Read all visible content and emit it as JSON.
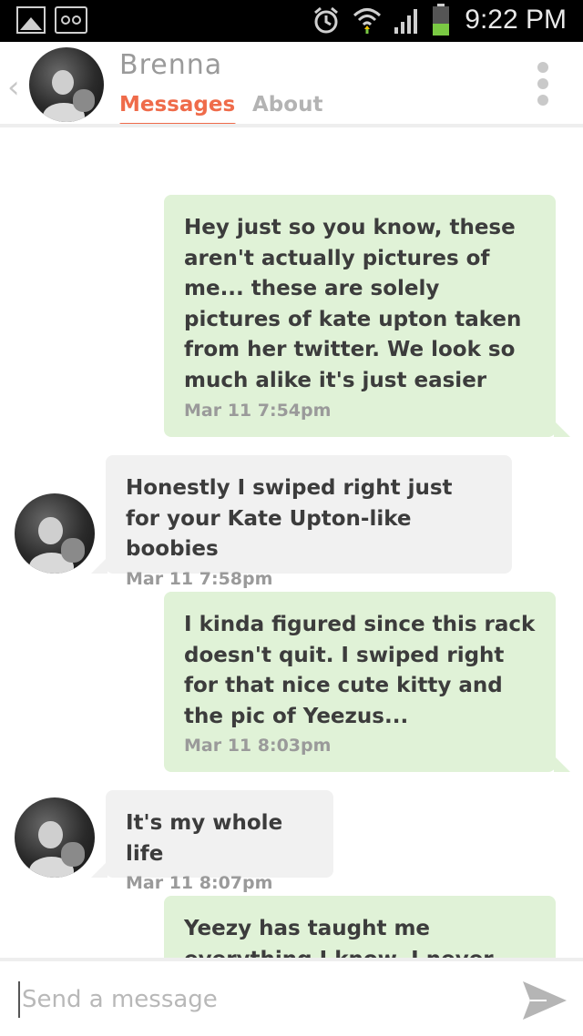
{
  "status_bar": {
    "time": "9:22 PM",
    "icons": [
      "gallery-icon",
      "voicemail-icon",
      "alarm-icon",
      "wifi-icon",
      "signal-icon",
      "battery-icon"
    ]
  },
  "header": {
    "name": "Brenna",
    "tabs": [
      {
        "label": "Messages",
        "active": true
      },
      {
        "label": "About",
        "active": false
      }
    ],
    "accent_color": "#ef6b4a"
  },
  "messages": [
    {
      "direction": "sent",
      "text": "Hey just so you know, these aren't actually pictures of me... these are solely pictures of kate upton taken from her twitter. We look so much alike it's just easier",
      "time": "Mar 11  7:54pm"
    },
    {
      "direction": "received",
      "text": "Honestly I swiped right just for your Kate Upton-like boobies",
      "time": "Mar 11  7:58pm"
    },
    {
      "direction": "sent",
      "text": "I kinda figured since this rack doesn't quit. I swiped right for that nice cute kitty and the pic of Yeezus...",
      "time": "Mar 11  8:03pm"
    },
    {
      "direction": "received",
      "text": "It's my whole life",
      "time": "Mar 11  8:07pm"
    },
    {
      "direction": "sent",
      "text": "Yeezy has taught me everything I know. I never",
      "time": ""
    }
  ],
  "composer": {
    "placeholder": "Send a message"
  },
  "colors": {
    "sent_bubble": "#e0f2d7",
    "received_bubble": "#f1f1f1"
  }
}
